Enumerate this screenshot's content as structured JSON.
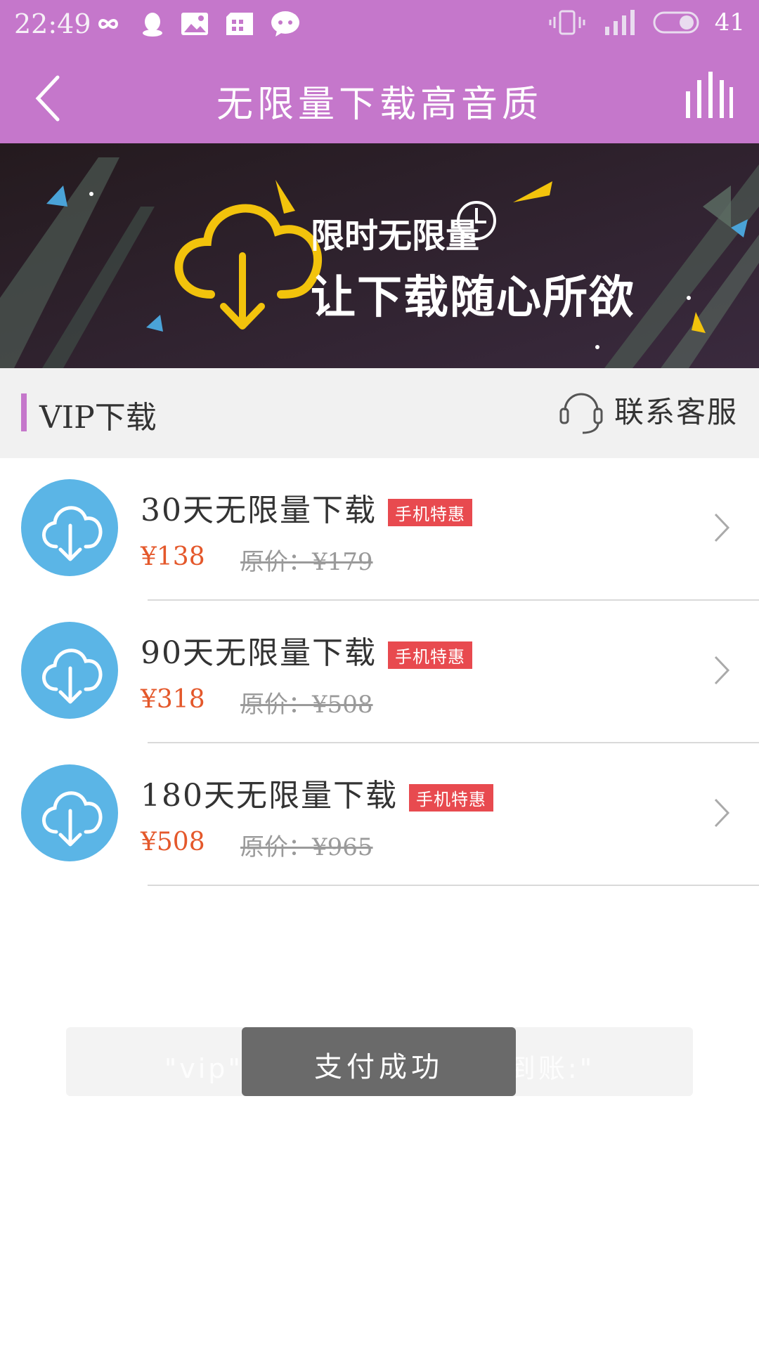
{
  "status_bar": {
    "time": "22:49",
    "battery": "41"
  },
  "header": {
    "title": "无限量下载高音质"
  },
  "banner": {
    "line1": "限时无限量",
    "line2": "让下载随心所欲"
  },
  "section": {
    "title": "VIP下载",
    "contact_label": "联系客服"
  },
  "plans": [
    {
      "name": "30天无限量下载",
      "badge": "手机特惠",
      "price": "¥138",
      "original": "原价：¥179"
    },
    {
      "name": "90天无限量下载",
      "badge": "手机特惠",
      "price": "¥318",
      "original": "原价：¥508"
    },
    {
      "name": "180天无限量下载",
      "badge": "手机特惠",
      "price": "¥508",
      "original": "原价：¥965"
    }
  ],
  "toast": {
    "message": "支付成功",
    "background_message": "\"vip\"支付完成，稍等即将到账:\""
  },
  "colors": {
    "header": "#c577cb",
    "icon": "#5bb5e6",
    "badge": "#e84a4f",
    "price": "#e4582b"
  }
}
